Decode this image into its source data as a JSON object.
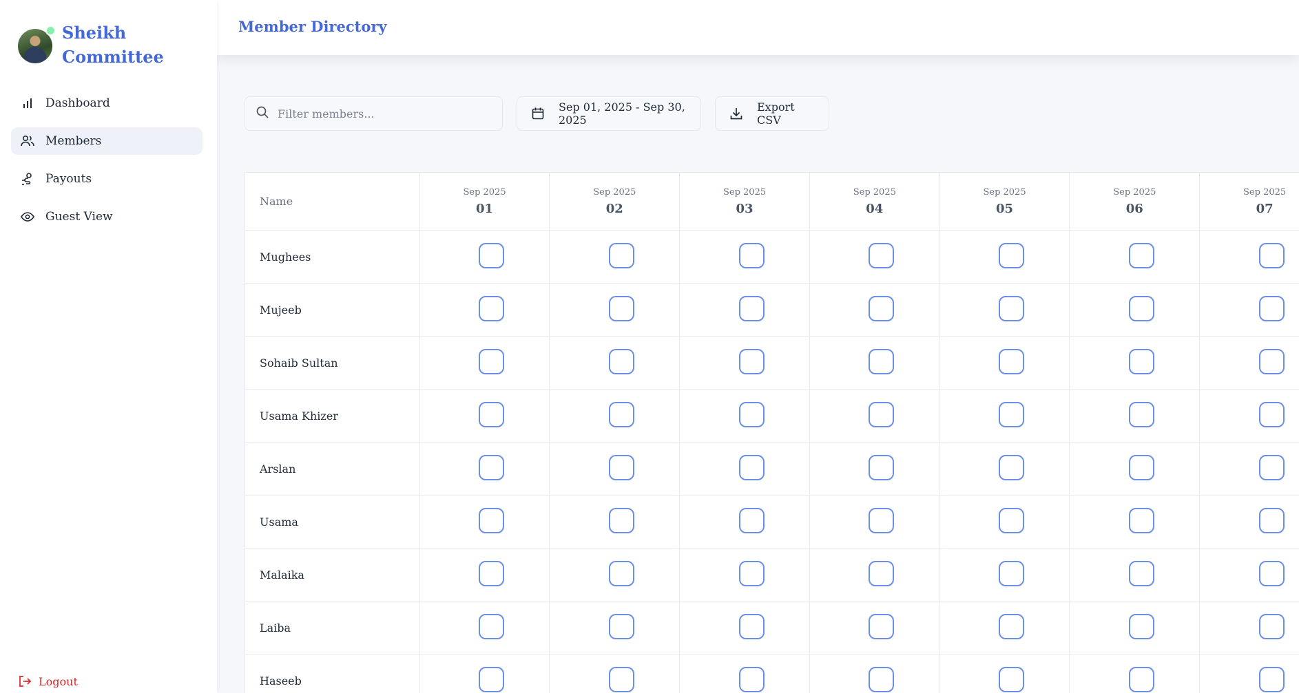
{
  "sidebar": {
    "brand": "Sheikh Committee",
    "nav": [
      {
        "label": "Dashboard",
        "icon": "bar-chart-icon"
      },
      {
        "label": "Members",
        "icon": "users-icon",
        "active": true
      },
      {
        "label": "Payouts",
        "icon": "payout-hand-icon"
      },
      {
        "label": "Guest View",
        "icon": "eye-icon"
      }
    ],
    "logout": "Logout"
  },
  "header": {
    "title": "Member Directory"
  },
  "toolbar": {
    "search_placeholder": "Filter members...",
    "date_range": "Sep 01, 2025 - Sep 30, 2025",
    "export_label": "Export CSV"
  },
  "table": {
    "name_header": "Name",
    "days": [
      {
        "month": "Sep 2025",
        "day": "01"
      },
      {
        "month": "Sep 2025",
        "day": "02"
      },
      {
        "month": "Sep 2025",
        "day": "03"
      },
      {
        "month": "Sep 2025",
        "day": "04"
      },
      {
        "month": "Sep 2025",
        "day": "05"
      },
      {
        "month": "Sep 2025",
        "day": "06"
      },
      {
        "month": "Sep 2025",
        "day": "07"
      }
    ],
    "members": [
      "Mughees",
      "Mujeeb",
      "Sohaib Sultan",
      "Usama Khizer",
      "Arslan",
      "Usama",
      "Malaika",
      "Laiba",
      "Haseeb"
    ]
  },
  "colors": {
    "accent": "#4469d6",
    "online": "#86efac",
    "logout": "#dc2626",
    "checkbox_border": "#6b8fe6"
  }
}
